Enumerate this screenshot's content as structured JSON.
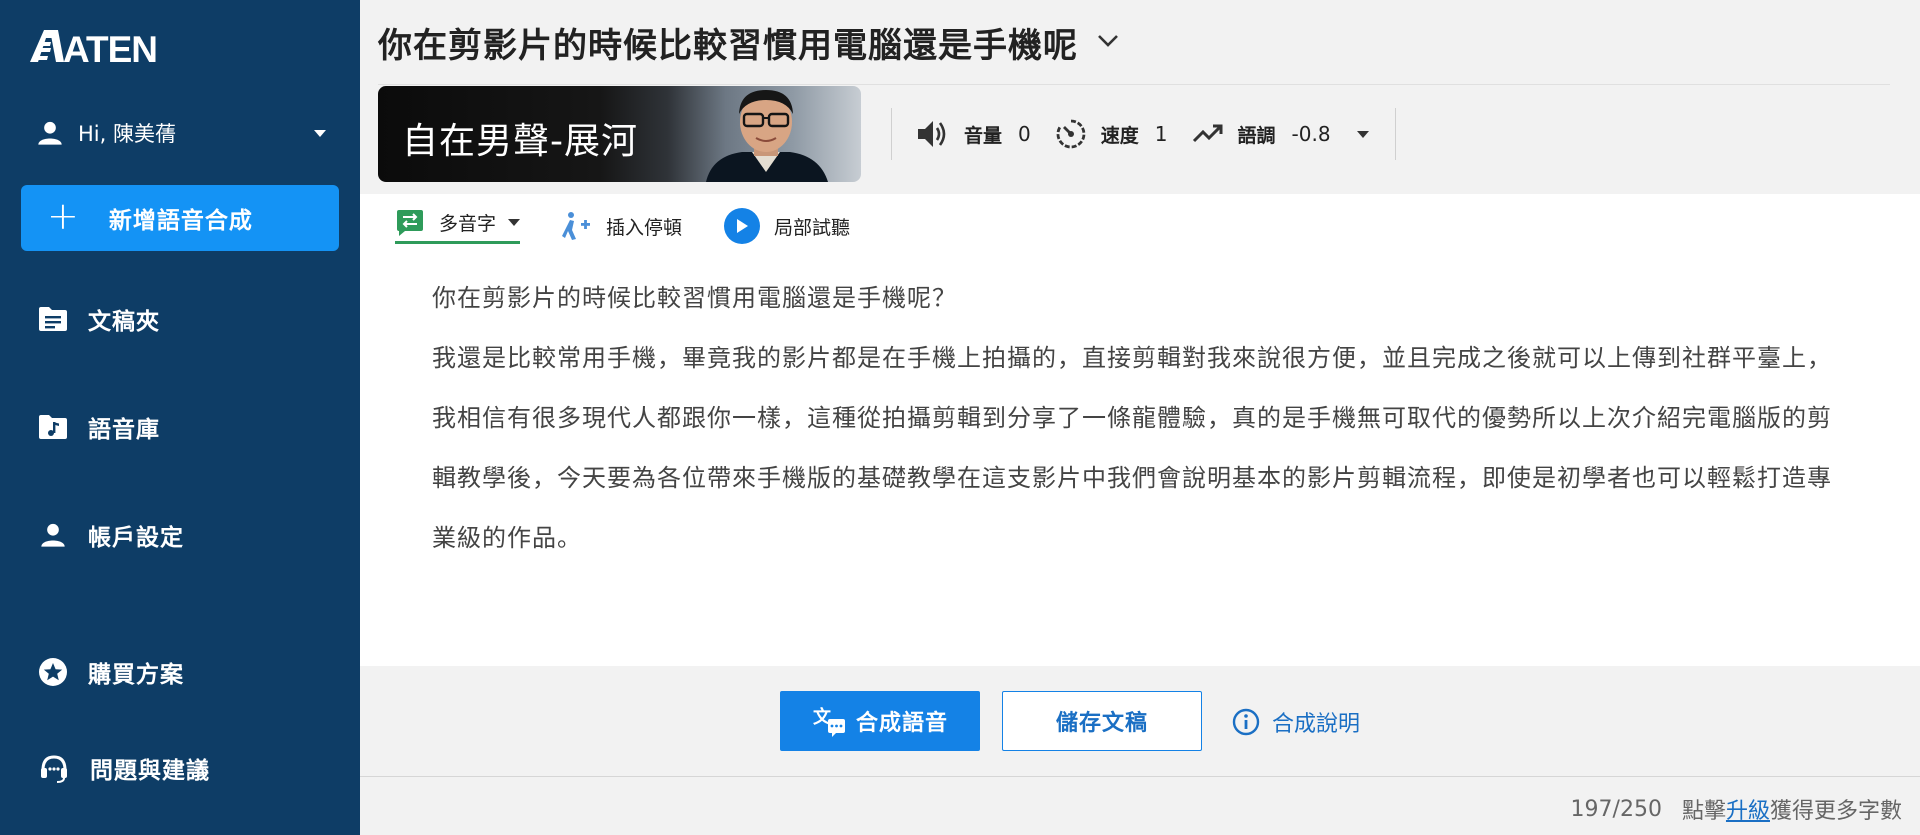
{
  "brand": {
    "logo_text": "ATEN"
  },
  "sidebar": {
    "greeting": "Hi, 陳美蒨",
    "new_button": "新增語音合成",
    "items": [
      {
        "label": "文稿夾",
        "icon": "folder-document-icon"
      },
      {
        "label": "語音庫",
        "icon": "folder-music-icon"
      },
      {
        "label": "帳戶設定",
        "icon": "user-icon"
      },
      {
        "label": "購買方案",
        "icon": "star-circle-icon"
      },
      {
        "label": "問題與建議",
        "icon": "headset-icon"
      }
    ]
  },
  "document": {
    "title": "你在剪影片的時候比較習慣用電腦還是手機呢"
  },
  "voice": {
    "name": "自在男聲-展河"
  },
  "controls": {
    "volume_label": "音量",
    "volume_value": "0",
    "speed_label": "速度",
    "speed_value": "1",
    "pitch_label": "語調",
    "pitch_value": "-0.8"
  },
  "toolbar": {
    "polyphone": "多音字",
    "insert_pause": "插入停頓",
    "partial_preview": "局部試聽"
  },
  "content": {
    "paragraphs": [
      "你在剪影片的時候比較習慣用電腦還是手機呢？",
      "我還是比較常用手機，畢竟我的影片都是在手機上拍攝的，直接剪輯對我來說很方便，並且完成之後就可以上傳到社群平臺上，",
      "我相信有很多現代人都跟你一樣，這種從拍攝剪輯到分享了一條龍體驗，真的是手機無可取代的優勢所以上次介紹完電腦版的剪輯教學後，今天要為各位帶來手機版的基礎教學在這支影片中我們會說明基本的影片剪輯流程，即使是初學者也可以輕鬆打造專業級的作品。"
    ]
  },
  "actions": {
    "synthesize": "合成語音",
    "save": "儲存文稿",
    "help": "合成說明"
  },
  "footer": {
    "count": "197/250",
    "prefix": "點擊",
    "upgrade": "升級",
    "suffix": "獲得更多字數"
  },
  "colors": {
    "sidebar": "#0e3d66",
    "primary": "#1482e6",
    "new_button": "#1493f5",
    "polyphone_green": "#2e9b5a"
  }
}
